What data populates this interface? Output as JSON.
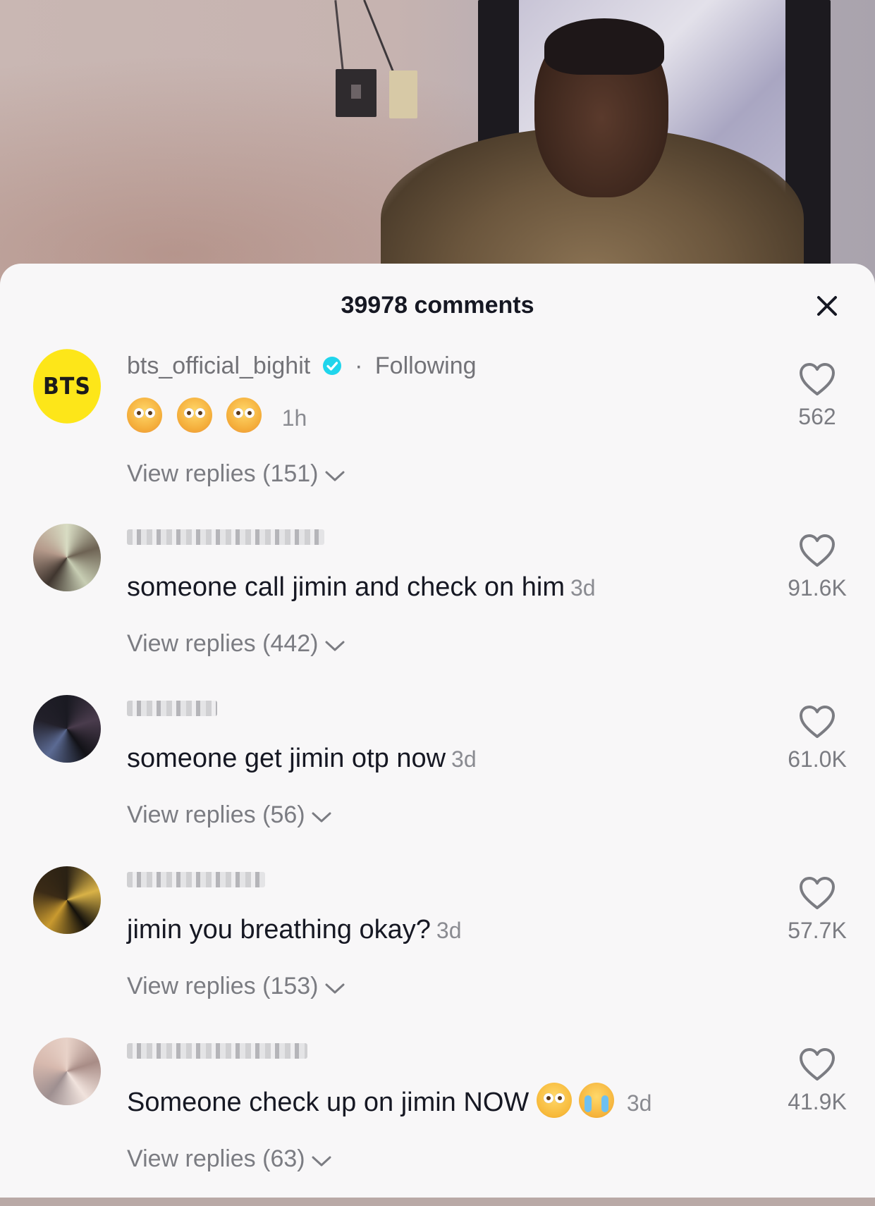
{
  "header": {
    "title": "39978 comments"
  },
  "comments": [
    {
      "avatar_text": "BTS",
      "username": "bts_official_bighit",
      "verified": true,
      "following_label": "Following",
      "text": "",
      "emojis": [
        "flushed-face",
        "flushed-face",
        "flushed-face"
      ],
      "time": "1h",
      "likes": "562",
      "replies_label": "View replies (151)"
    },
    {
      "username_blurred": true,
      "text": "someone call jimin and check on him",
      "time": "3d",
      "likes": "91.6K",
      "replies_label": "View replies (442)"
    },
    {
      "username_blurred": true,
      "text": "someone get jimin otp now",
      "time": "3d",
      "likes": "61.0K",
      "replies_label": "View replies (56)"
    },
    {
      "username_blurred": true,
      "text": "jimin you breathing okay?",
      "time": "3d",
      "likes": "57.7K",
      "replies_label": "View replies (153)"
    },
    {
      "username_blurred": true,
      "text": "Someone check up on jimin NOW",
      "emojis": [
        "pleading-face",
        "loudly-crying-face"
      ],
      "time": "3d",
      "likes": "41.9K",
      "replies_label": "View replies (63)"
    }
  ],
  "icons": {
    "close": "close-icon",
    "like": "heart-outline-icon",
    "verified": "verified-badge-icon",
    "chevron": "chevron-down-icon"
  },
  "colors": {
    "bts_avatar": "#fde619",
    "verified": "#20d5ec",
    "sheet_bg": "#f8f7f8"
  }
}
